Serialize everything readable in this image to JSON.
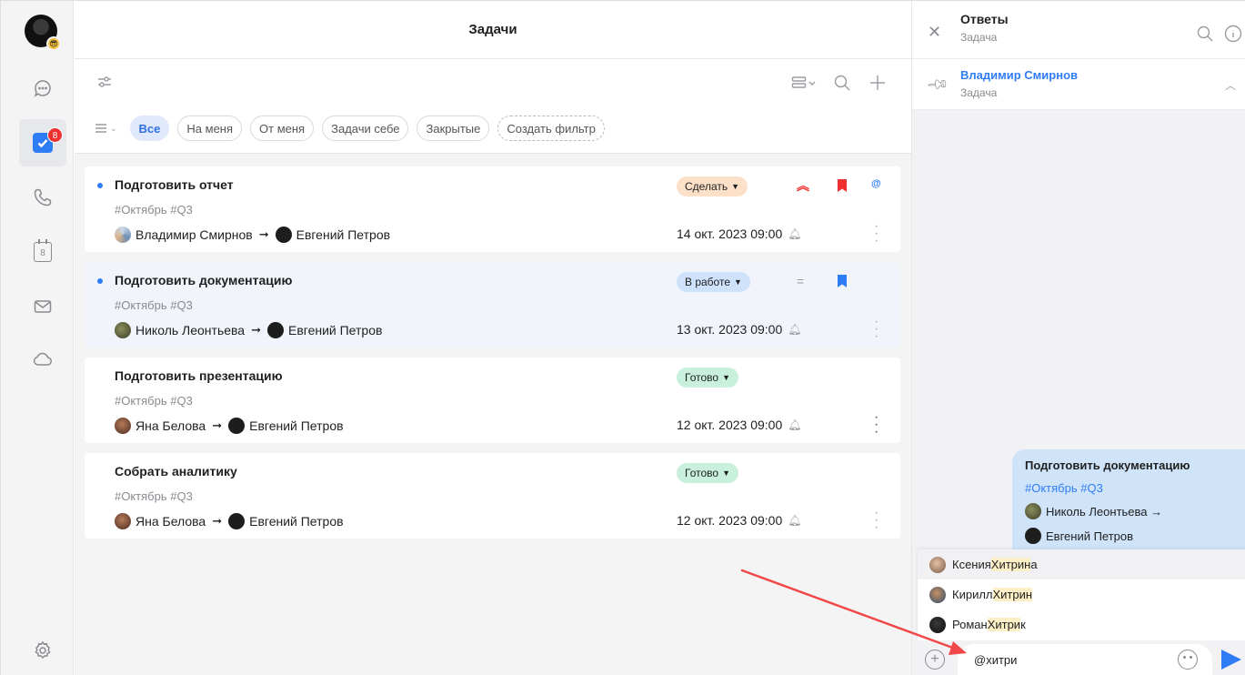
{
  "main": {
    "title": "Задачи",
    "filters": [
      {
        "label": "Все",
        "active": true
      },
      {
        "label": "На меня"
      },
      {
        "label": "От меня"
      },
      {
        "label": "Задачи себе"
      },
      {
        "label": "Закрытые"
      },
      {
        "label": "Создать фильтр",
        "dashed": true
      }
    ]
  },
  "rail": {
    "tasks_badge": "8",
    "calendar_day": "8"
  },
  "tasks": [
    {
      "title": "Подготовить отчет",
      "tags": "#Октябрь #Q3",
      "from": "Владимир Смирнов",
      "to": "Евгений Петров",
      "status": "Сделать",
      "due": "14 окт. 2023 09:00",
      "priority": "high",
      "bookmark": "red",
      "mention": "@"
    },
    {
      "title": "Подготовить документацию",
      "tags": "#Октябрь #Q3",
      "from": "Николь Леонтьева",
      "to": "Евгений Петров",
      "status": "В работе",
      "due": "13 окт. 2023 09:00",
      "priority": "medium",
      "bookmark": "blue"
    },
    {
      "title": "Подготовить презентацию",
      "tags": "#Октябрь #Q3",
      "from": "Яна Белова",
      "to": "Евгений Петров",
      "status": "Готово",
      "due": "12 окт. 2023 09:00"
    },
    {
      "title": "Собрать аналитику",
      "tags": "#Октябрь #Q3",
      "from": "Яна Белова",
      "to": "Евгений Петров",
      "status": "Готово",
      "due": "12 окт. 2023 09:00"
    }
  ],
  "panel": {
    "title": "Ответы",
    "subtitle": "Задача",
    "pinned_name": "Владимир Смирнов",
    "pinned_sub": "Задача",
    "bubble": {
      "title": "Подготовить документацию",
      "tags": "#Октябрь #Q3",
      "from": "Николь Леонтьева →",
      "to": "Евгений Петров"
    },
    "suggestions": [
      {
        "first": "Ксения ",
        "match": "Хитрин",
        "rest": "а"
      },
      {
        "first": "Кирилл ",
        "match": "Хитрин",
        "rest": ""
      },
      {
        "first": "Роман ",
        "match": "Хитри",
        "rest": "к"
      }
    ],
    "input_value": "@хитри"
  },
  "colors": {
    "accent": "#2f7df6",
    "danger": "#f0302f",
    "annotation_arrow": "#f04848"
  }
}
